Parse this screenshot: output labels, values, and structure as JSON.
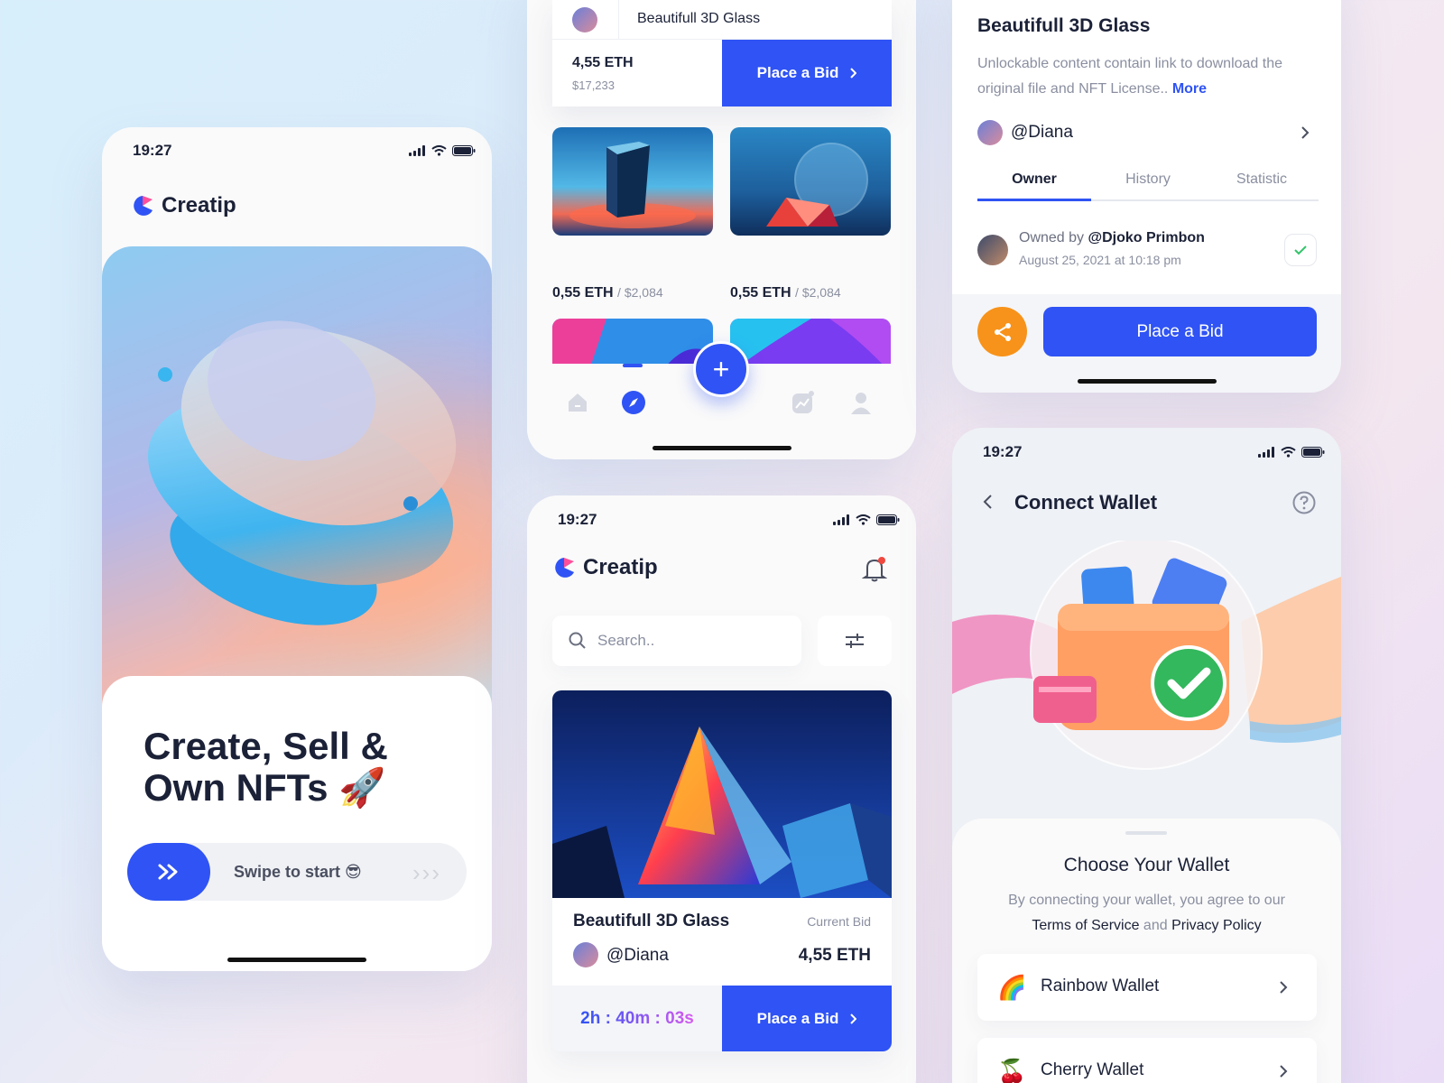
{
  "status_time": "19:27",
  "brand": {
    "name": "Creatip"
  },
  "onboarding": {
    "headline_line1": "Create, Sell &",
    "headline_line2": "Own NFTs 🚀",
    "swipe_label": "Swipe to start 😎"
  },
  "browse": {
    "top_item": {
      "title": "Beautifull 3D Glass",
      "price_eth": "4,55 ETH",
      "price_usd": "$17,233",
      "bid_label": "Place a Bid"
    },
    "tiles": [
      {
        "eth": "0,55 ETH",
        "usd": "/ $2,084"
      },
      {
        "eth": "0,55 ETH",
        "usd": "/ $2,084"
      }
    ],
    "nav_icons": [
      "home-icon",
      "compass-icon",
      "plus-icon",
      "chart-icon",
      "user-icon"
    ]
  },
  "detail": {
    "title": "Beautifull 3D Glass",
    "description": "Unlockable content contain link to download the original file and NFT License..",
    "more_link": "More",
    "creator": "@Diana",
    "tabs": [
      "Owner",
      "History",
      "Statistic"
    ],
    "owner_prefix": "Owned by",
    "owner_handle": "@Djoko Primbon",
    "owner_date": "August 25, 2021 at 10:18 pm",
    "bid_label": "Place a Bid",
    "share_color": "#f7931a"
  },
  "home": {
    "search_placeholder": "Search..",
    "featured": {
      "title": "Beautifull 3D Glass",
      "current_bid_label": "Current Bid",
      "creator": "@Diana",
      "current_bid": "4,55 ETH",
      "countdown": "2h : 40m : 03s",
      "bid_label": "Place a Bid"
    }
  },
  "wallet": {
    "title": "Connect Wallet",
    "sheet_title": "Choose Your Wallet",
    "agree_text": "By connecting your wallet, you agree to our",
    "terms": "Terms of Service",
    "and": "and",
    "privacy": "Privacy Policy",
    "items": [
      {
        "name": "Rainbow Wallet",
        "emoji": "🌈"
      },
      {
        "name": "Cherry Wallet",
        "emoji": "🍒"
      }
    ]
  },
  "colors": {
    "accent": "#2f53f4",
    "text": "#1b2137",
    "muted": "#8a8fa0",
    "share": "#f7931a",
    "success": "#33c46a"
  }
}
